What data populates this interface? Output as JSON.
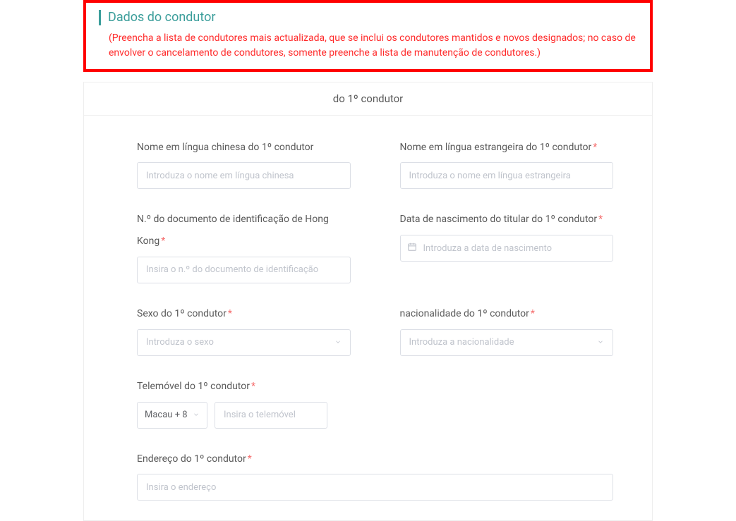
{
  "header": {
    "title": "Dados do condutor",
    "note": "(Preencha a lista de condutores mais actualizada, que se inclui os condutores mantidos e novos designados; no caso de envolver o cancelamento de condutores, somente preenche a lista de manutenção de condutores.)"
  },
  "card": {
    "title": "do 1º condutor"
  },
  "fields": {
    "nome_cn": {
      "label": "Nome em língua chinesa do 1º condutor",
      "placeholder": "Introduza o nome em língua chinesa"
    },
    "nome_fr": {
      "label": "Nome em língua estrangeira do 1º condutor",
      "placeholder": "Introduza o nome em língua estrangeira"
    },
    "doc_hk": {
      "label": "N.º do documento de identificação de Hong Kong",
      "placeholder": "Insira o n.º do documento de identificação"
    },
    "nascimento": {
      "label": "Data de nascimento do titular do 1º condutor",
      "placeholder": "Introduza a data de nascimento"
    },
    "sexo": {
      "label": "Sexo do 1º condutor",
      "placeholder": "Introduza o sexo"
    },
    "nacionalidade": {
      "label": "nacionalidade do 1º condutor",
      "placeholder": "Introduza a nacionalidade"
    },
    "telemovel": {
      "label": "Telemóvel do 1º condutor",
      "prefix": "Macau + 8",
      "placeholder": "Insira o telemóvel"
    },
    "endereco": {
      "label": "Endereço do 1º condutor",
      "placeholder": "Insira o endereço"
    }
  }
}
